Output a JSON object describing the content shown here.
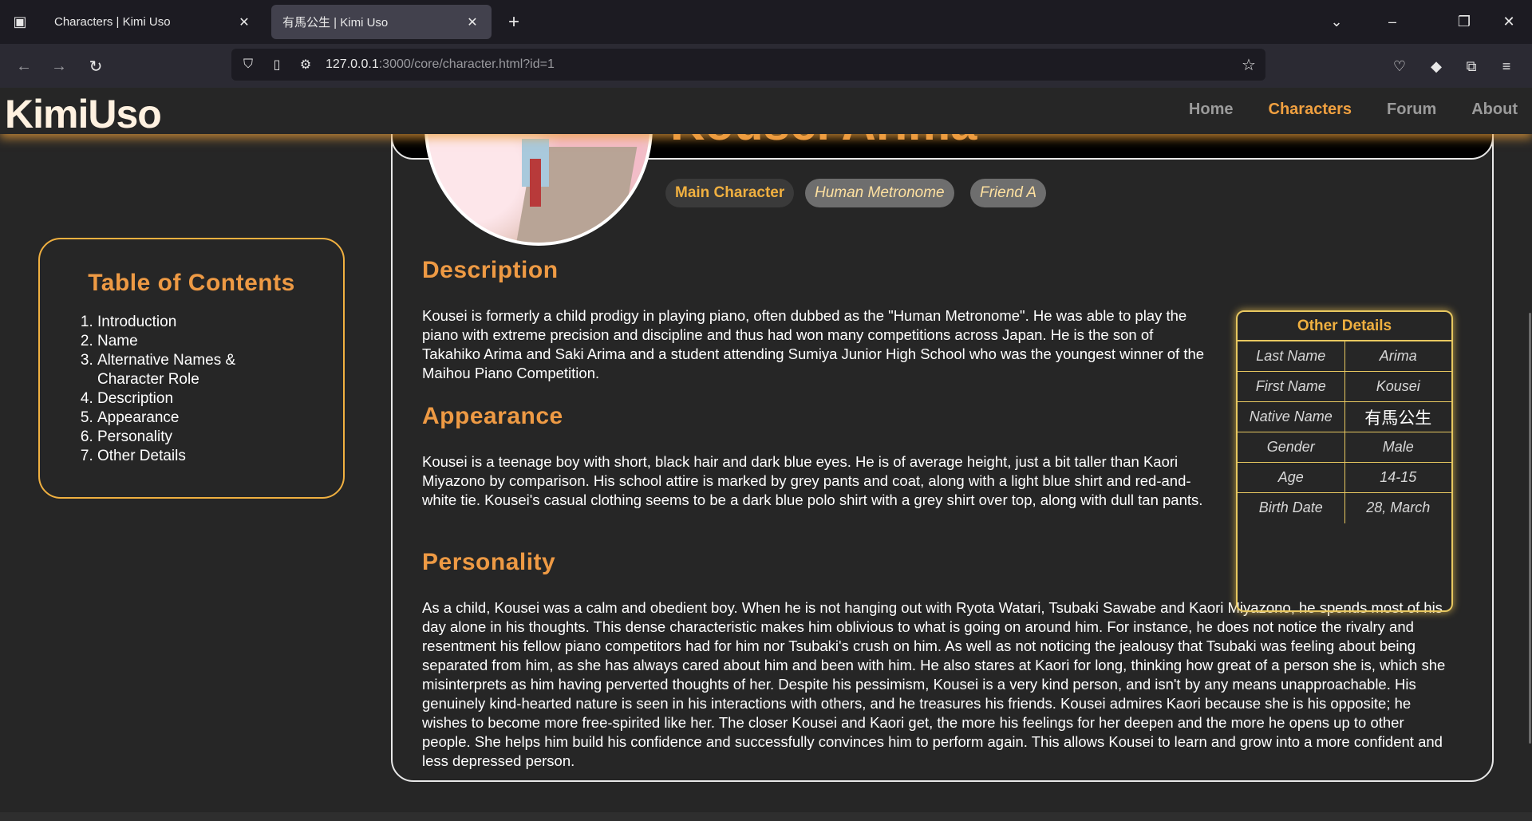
{
  "browser": {
    "tabs": [
      {
        "title": "Characters | Kimi Uso",
        "active": false
      },
      {
        "title": "有馬公生 | Kimi Uso",
        "active": true
      }
    ],
    "url_host": "127.0.0.1",
    "url_rest": ":3000/core/character.html?id=1"
  },
  "site": {
    "logo": "KimiUso",
    "nav": [
      "Home",
      "Characters",
      "Forum",
      "About"
    ],
    "accent": "#ee9a44"
  },
  "character": {
    "name": "Kousei Arima",
    "tags": [
      "Main Character",
      "Human Metronome",
      "Friend A"
    ]
  },
  "toc": {
    "title": "Table of Contents",
    "items": [
      "Introduction",
      "Name",
      "Alternative Names & Character Role",
      "Description",
      "Appearance",
      "Personality",
      "Other Details"
    ]
  },
  "sections": {
    "description": {
      "title": "Description",
      "text": "Kousei is formerly a child prodigy in playing piano, often dubbed as the \"Human Metronome\". He was able to play the piano with extreme precision and discipline and thus had won many competitions across Japan. He is the son of Takahiko Arima and Saki Arima and a student attending Sumiya Junior High School who was the youngest winner of the Maihou Piano Competition."
    },
    "appearance": {
      "title": "Appearance",
      "text": "Kousei is a teenage boy with short, black hair and dark blue eyes. He is of average height, just a bit taller than Kaori Miyazono by comparison. His school attire is marked by grey pants and coat, along with a light blue shirt and red-and-white tie. Kousei's casual clothing seems to be a dark blue polo shirt with a grey shirt over top, along with dull tan pants."
    },
    "personality": {
      "title": "Personality",
      "text": "As a child, Kousei was a calm and obedient boy. When he is not hanging out with Ryota Watari, Tsubaki Sawabe and Kaori Miyazono, he spends most of his day alone in his thoughts. This dense characteristic makes him oblivious to what is going on around him. For instance, he does not notice the rivalry and resentment his fellow piano competitors had for him nor Tsubaki's crush on him. As well as not noticing the jealousy that Tsubaki was feeling about being separated from him, as she has always cared about him and been with him. He also stares at Kaori for long, thinking how great of a person she is, which she misinterprets as him having perverted thoughts of her. Despite his pessimism, Kousei is a very kind person, and isn't by any means unapproachable. His genuinely kind-hearted nature is seen in his interactions with others, and he treasures his friends. Kousei admires Kaori because she is his opposite; he wishes to become more free-spirited like her. The closer Kousei and Kaori get, the more his feelings for her deepen and the more he opens up to other people. She helps him build his confidence and successfully convinces him to perform again. This allows Kousei to learn and grow into a more confident and less depressed person."
    }
  },
  "details": {
    "title": "Other Details",
    "rows": [
      {
        "label": "Last Name",
        "value": "Arima"
      },
      {
        "label": "First Name",
        "value": "Kousei"
      },
      {
        "label": "Native Name",
        "value": "有馬公生"
      },
      {
        "label": "Gender",
        "value": "Male"
      },
      {
        "label": "Age",
        "value": "14-15"
      },
      {
        "label": "Birth Date",
        "value": "28, March"
      }
    ]
  }
}
